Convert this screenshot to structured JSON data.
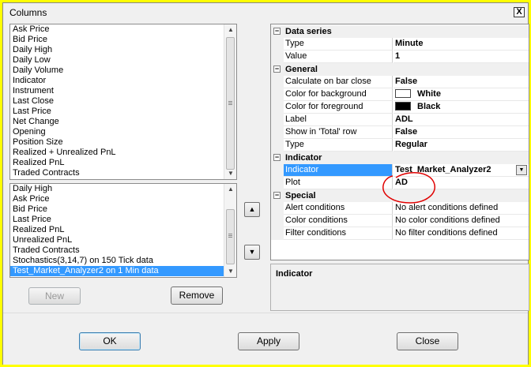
{
  "window": {
    "title": "Columns",
    "close_glyph": "X"
  },
  "available_list": {
    "items": [
      "Ask Price",
      "Bid Price",
      "Daily High",
      "Daily Low",
      "Daily Volume",
      "Indicator",
      "Instrument",
      "Last Close",
      "Last Price",
      "Net Change",
      "Opening",
      "Position Size",
      "Realized + Unrealized PnL",
      "Realized PnL",
      "Traded Contracts"
    ]
  },
  "selected_list": {
    "items": [
      "Daily High",
      "Ask Price",
      "Bid Price",
      "Last Price",
      "Realized PnL",
      "Unrealized PnL",
      "Traded Contracts",
      "Stochastics(3,14,7) on 150 Tick data",
      "Test_Market_Analyzer2 on 1 Min data"
    ],
    "selected_index": 8
  },
  "buttons": {
    "new": "New",
    "remove": "Remove",
    "ok": "OK",
    "apply": "Apply",
    "close": "Close"
  },
  "icons": {
    "move_up": "up-arrow-icon",
    "move_down": "down-arrow-icon"
  },
  "properties": {
    "data_series": {
      "label": "Data series",
      "type_name": "Type",
      "type_value": "Minute",
      "value_name": "Value",
      "value_value": "1"
    },
    "general": {
      "label": "General",
      "calc_name": "Calculate on bar close",
      "calc_value": "False",
      "bg_name": "Color for background",
      "bg_value": "White",
      "fg_name": "Color for foreground",
      "fg_value": "Black",
      "label_name": "Label",
      "label_value": "ADL",
      "total_name": "Show in 'Total' row",
      "total_value": "False",
      "type_name": "Type",
      "type_value": "Regular"
    },
    "indicator": {
      "label": "Indicator",
      "ind_name": "Indicator",
      "ind_value": "Test_Market_Analyzer2",
      "plot_name": "Plot",
      "plot_value": "AD"
    },
    "special": {
      "label": "Special",
      "alert_name": "Alert conditions",
      "alert_value": "No alert conditions defined",
      "color_name": "Color conditions",
      "color_value": "No color conditions defined",
      "filter_name": "Filter conditions",
      "filter_value": "No filter conditions defined"
    }
  },
  "description": {
    "title": "Indicator"
  },
  "colors": {
    "selection": "#3399ff",
    "annotation": "#e00000",
    "bg_swatch": "#ffffff",
    "fg_swatch": "#000000"
  }
}
